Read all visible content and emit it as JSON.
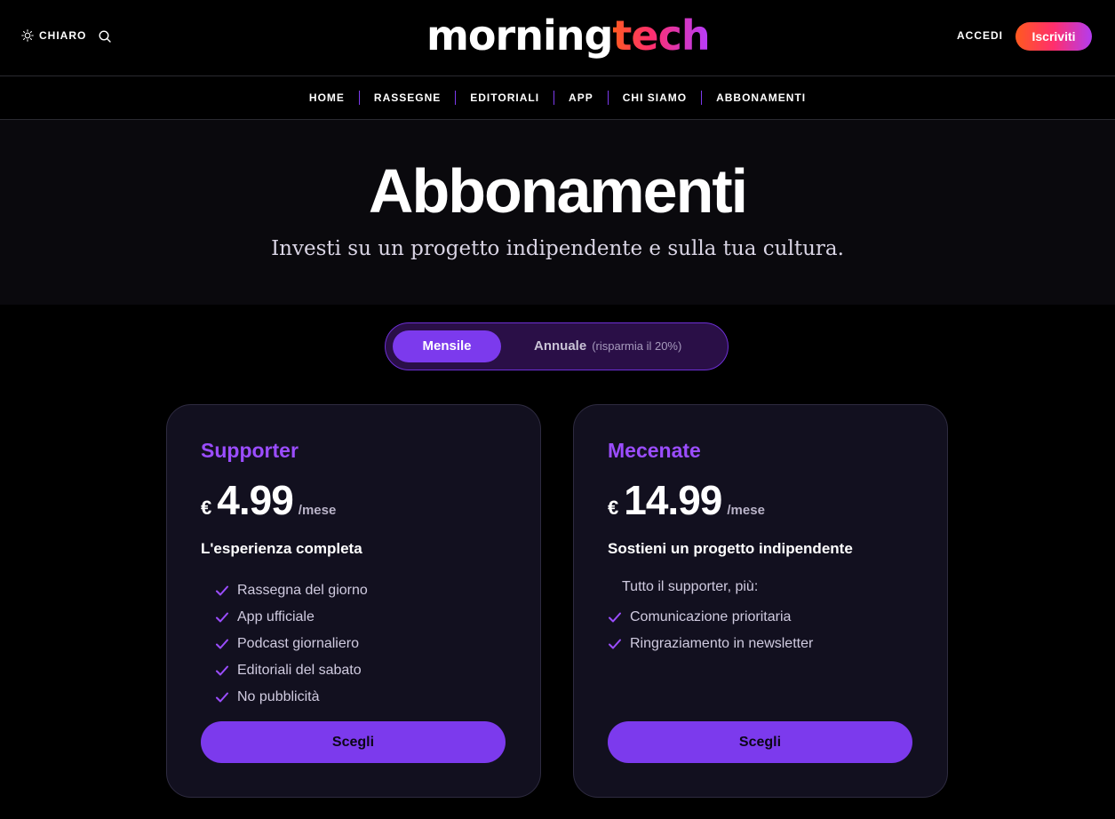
{
  "header": {
    "theme_label": "CHIARO",
    "logo_part1": "morning",
    "logo_part2": "tech",
    "login_label": "ACCEDI",
    "signup_label": "Iscriviti"
  },
  "nav": {
    "items": [
      "HOME",
      "RASSEGNE",
      "EDITORIALI",
      "APP",
      "CHI SIAMO",
      "ABBONAMENTI"
    ]
  },
  "hero": {
    "title": "Abbonamenti",
    "subtitle": "Investi su un progetto indipendente e sulla tua cultura."
  },
  "billing": {
    "monthly_label": "Mensile",
    "annual_label": "Annuale",
    "annual_note": "(risparmia il 20%)",
    "selected": "Mensile"
  },
  "plans": [
    {
      "name": "Supporter",
      "currency": "€",
      "amount": "4.99",
      "period": "/mese",
      "tagline": "L'esperienza completa",
      "intro": "",
      "features": [
        "Rassegna del giorno",
        "App ufficiale",
        "Podcast giornaliero",
        "Editoriali del sabato",
        "No pubblicità"
      ],
      "button_label": "Scegli"
    },
    {
      "name": "Mecenate",
      "currency": "€",
      "amount": "14.99",
      "period": "/mese",
      "tagline": "Sostieni un progetto indipendente",
      "intro": "Tutto il supporter, più:",
      "features": [
        "Comunicazione prioritaria",
        "Ringraziamento in newsletter"
      ],
      "button_label": "Scegli"
    }
  ],
  "colors": {
    "accent": "#7c3aed",
    "plan_name": "#9b4dff",
    "background": "#000000",
    "card_background": "#12101f"
  },
  "icons": {
    "theme": "sun-icon",
    "search": "search-icon",
    "feature": "check-icon"
  }
}
